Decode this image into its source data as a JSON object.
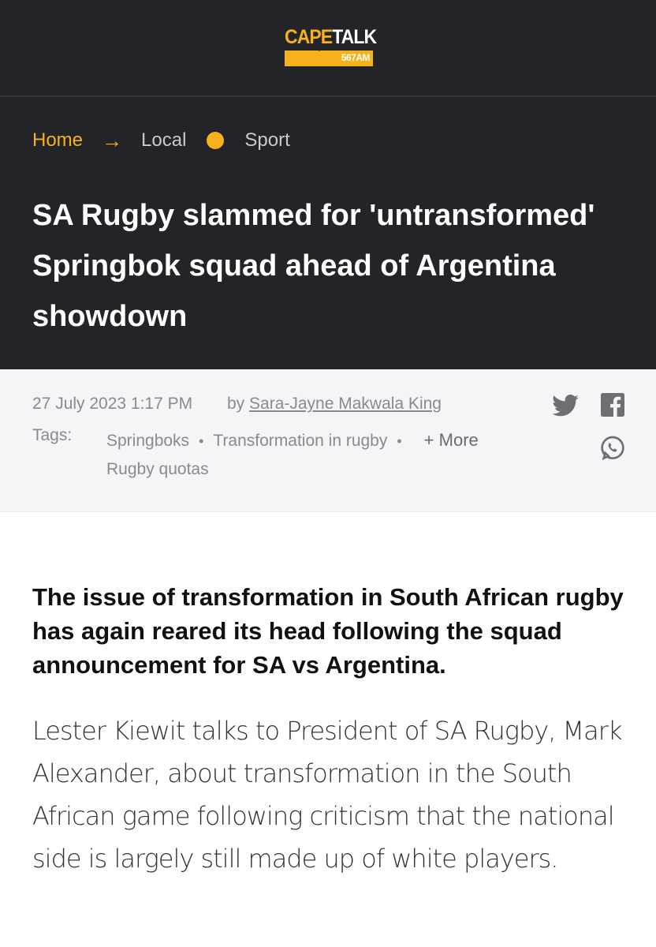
{
  "brand": {
    "name_part1": "CAPE",
    "name_part2": "TALK",
    "frequency": "567AM",
    "primary_color": "#f7b21b",
    "header_bg": "#232427"
  },
  "breadcrumb": {
    "home": "Home",
    "arrow": "→",
    "local": "Local",
    "sport": "Sport"
  },
  "article": {
    "headline": "SA Rugby slammed for 'untransformed' Springbok squad ahead of Argentina showdown",
    "date": "27 July 2023 1:17 PM",
    "by_label": "by",
    "author": "Sara-Jayne Makwala King",
    "tags_label": "Tags:",
    "tags": [
      "Springboks",
      "Transformation in rugby",
      "Rugby quotas"
    ],
    "tag_separator": "•",
    "more_label": "+ More",
    "lead": "The issue of transformation in South African rugby has again reared its head following the squad announcement for SA vs Argentina.",
    "body": "Lester Kiewit talks to President of SA Rugby, Mark Alexander, about transformation in the South African game following criticism that the national side is largely still made up of white players."
  },
  "share": {
    "icons": [
      "twitter-icon",
      "facebook-icon",
      "whatsapp-icon"
    ]
  }
}
